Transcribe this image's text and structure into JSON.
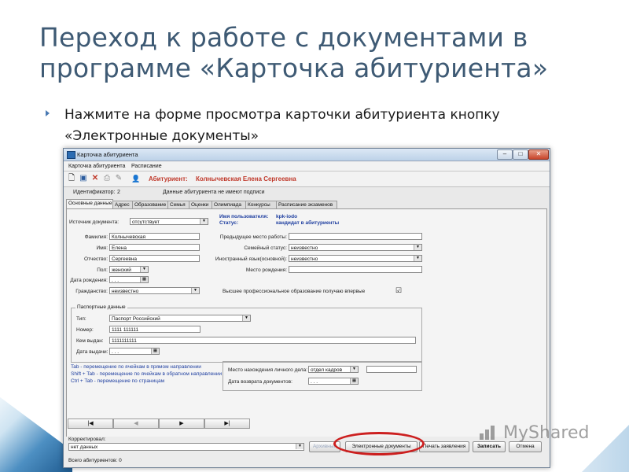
{
  "slide": {
    "title": "Переход к работе с документами в программе «Карточка абитуриента»",
    "bullet": "Нажмите на форме просмотра карточки абитуриента кнопку «Электронные документы»"
  },
  "window": {
    "title": "Карточка абитуриента",
    "menu": [
      "Карточка абитуриента",
      "Расписание"
    ],
    "toolbar_icons": [
      "new-document-icon",
      "save-icon",
      "delete-icon",
      "print-icon",
      "edit-icon"
    ],
    "applicant_label": "Абитуриент:",
    "applicant_name": "Колнычевская Елена Сергеевна",
    "id_label": "Идентификатор:",
    "id_value": "2",
    "signature_note": "Данные абитуриента не имеют подписи",
    "tabs": [
      "Основные данные",
      "Адрес",
      "Образование",
      "Семья",
      "Оценки",
      "Олимпиада",
      "Конкурсы",
      "Расписание экзаменов"
    ],
    "source_label": "Источник документа:",
    "source_value": "отсутствует",
    "username_label": "Имя пользователя:",
    "username_value": "kpk-iodo",
    "status_label": "Статус:",
    "status_value": "кандидат в абитуриенты",
    "surname_label": "Фамилия:",
    "surname_value": "Колнычевская",
    "name_label": "Имя:",
    "name_value": "Елена",
    "patronymic_label": "Отчество:",
    "patronymic_value": "Сергеевна",
    "gender_label": "Пол:",
    "gender_value": "женский",
    "birthdate_label": "Дата рождения:",
    "birthdate_value": ". . .",
    "citizenship_label": "Гражданство:",
    "citizenship_value": "неизвестно",
    "prev_work_label": "Предыдущее место работы:",
    "prev_work_value": "",
    "family_label": "Семейный статус:",
    "family_value": "неизвестно",
    "foreign_lang_label": "Иностранный язык(основной):",
    "foreign_lang_value": "неизвестно",
    "birthplace_label": "Место рождения:",
    "birthplace_value": "",
    "higher_edu_label": "Высшее профессиональное образование получаю впервые",
    "higher_edu_checked": "☑",
    "passport": {
      "title": "Паспортные данные",
      "type_label": "Тип:",
      "type_value": "Паспорт Российский",
      "number_label": "Номер:",
      "number_value": "1111 111111",
      "issued_by_label": "Кем выдан:",
      "issued_by_value": "1111111111",
      "issue_date_label": "Дата выдачи:",
      "issue_date_value": ". . ."
    },
    "hints": [
      "Tab - перемещение по ячейкам в прямом направлении",
      "Shift + Tab - перемещение по ячейкам в обратном направлении",
      "Ctrl + Tab - перемещение по страницам"
    ],
    "storage_label": "Место нахождения личного дела:",
    "storage_value": "отдел кадров",
    "return_label": "Дата возврата документов:",
    "return_value": ". . .",
    "nav": [
      "|◀",
      "◀",
      "▶",
      "▶|"
    ],
    "corrected_label": "Корректировал:",
    "corrected_value": "нет данных",
    "buttons": {
      "archive": "Архивный",
      "edocs": "Электронные документы",
      "print": "Печать заявления",
      "record": "Записать",
      "cancel": "Отмена"
    },
    "status_bar": "Всего абитуриентов: 0"
  },
  "watermark": "MyShared",
  "colors": {
    "title": "#3e5a74",
    "accent": "#c0392b",
    "highlight": "#cc1f1f"
  }
}
